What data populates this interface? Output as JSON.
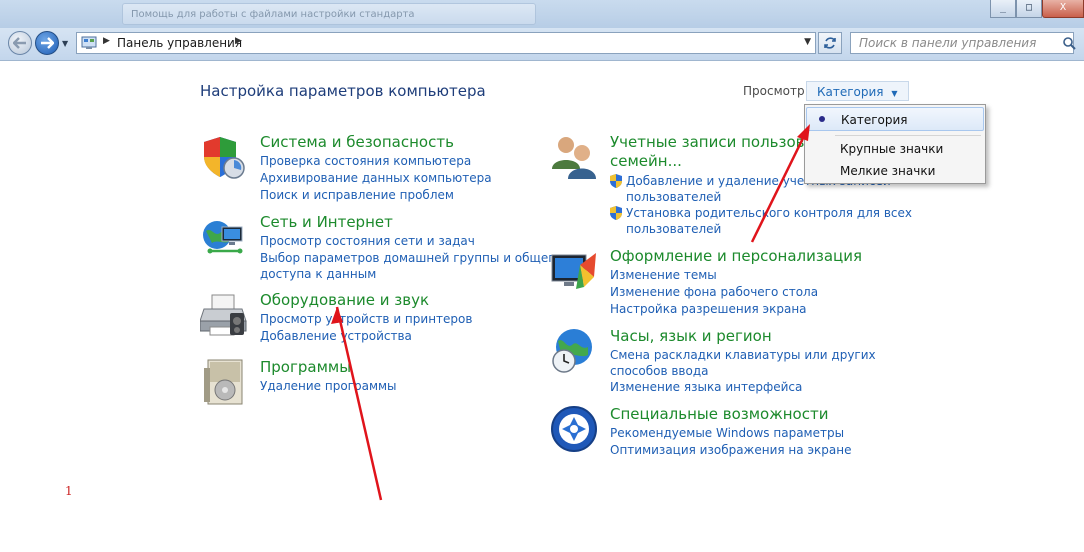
{
  "window": {
    "ghost_title": "Помощь для работы с файлами настройки стандарта",
    "minimize": "_",
    "maximize": "□",
    "close": "X"
  },
  "address": {
    "root": "Панель управления"
  },
  "search": {
    "placeholder": "Поиск в панели управления"
  },
  "content": {
    "title": "Настройка параметров компьютера",
    "view_label": "Просмотр:",
    "view_value": "Категория"
  },
  "view_menu": {
    "items": [
      "Категория",
      "Крупные значки",
      "Мелкие значки"
    ],
    "selected": "Категория"
  },
  "categories_left": [
    {
      "title": "Система и безопасность",
      "icon": "shield-icon",
      "links": [
        "Проверка состояния компьютера",
        "Архивирование данных компьютера",
        "Поиск и исправление проблем"
      ]
    },
    {
      "title": "Сеть и Интернет",
      "icon": "network-icon",
      "links": [
        "Просмотр состояния сети и задач",
        "Выбор параметров домашней группы и общего",
        "доступа к данным"
      ]
    },
    {
      "title": "Оборудование и звук",
      "icon": "printer-icon",
      "links": [
        "Просмотр устройств и принтеров",
        "Добавление устройства"
      ]
    },
    {
      "title": "Программы",
      "icon": "programs-icon",
      "links": [
        "Удаление программы"
      ]
    }
  ],
  "categories_right": [
    {
      "title_line1": "Учетные записи пользовател",
      "title_line2": "семейн...",
      "icon": "users-icon",
      "links": [
        "Добавление и удаление учетных записей",
        "пользователей",
        "Установка родительского контроля для всех",
        "пользователей"
      ]
    },
    {
      "title": "Оформление и персонализация",
      "icon": "display-icon",
      "links": [
        "Изменение темы",
        "Изменение фона рабочего стола",
        "Настройка разрешения экрана"
      ]
    },
    {
      "title": "Часы, язык и регион",
      "icon": "globe-clock-icon",
      "links": [
        "Смена раскладки клавиатуры или других",
        "способов ввода",
        "Изменение языка интерфейса"
      ]
    },
    {
      "title": "Специальные возможности",
      "icon": "accessibility-icon",
      "links": [
        "Рекомендуемые Windows параметры",
        "Оптимизация изображения на экране"
      ]
    }
  ],
  "annotation": {
    "page_number": "1",
    "arrow_color": "#e0141b"
  },
  "colors": {
    "category_title": "#1c8a2c",
    "link": "#1f5fb4",
    "heading": "#1e3d7a"
  }
}
